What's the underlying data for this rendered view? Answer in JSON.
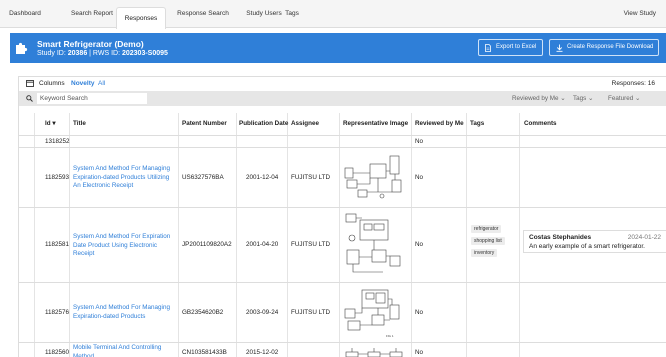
{
  "nav": {
    "tabs": [
      {
        "label": "Dashboard"
      },
      {
        "label": "Search Report"
      },
      {
        "label": "Responses"
      },
      {
        "label": "Response Search"
      },
      {
        "label": "Study Users"
      },
      {
        "label": "Tags"
      }
    ],
    "active_tab": "Responses",
    "view_study": "View Study"
  },
  "header": {
    "title": "Smart Refrigerator (Demo)",
    "study_id_label": "Study ID:",
    "study_id": "20386",
    "rws_label": "| RWS ID:",
    "rws_id": "202303-S0095",
    "export_label": "Export to Excel",
    "create_label": "Create Response File Download",
    "color": "#2f7fd8"
  },
  "toolbar": {
    "columns_label": "Columns",
    "novelty_label": "Novelty",
    "all_label": "All",
    "responses_label": "Responses: 16",
    "search_placeholder": "Keyword Search",
    "filters": {
      "reviewed": "Reviewed by Me",
      "tags": "Tags",
      "featured": "Featured"
    }
  },
  "table": {
    "headers": {
      "id": "Id",
      "title": "Title",
      "patent": "Patent Number",
      "pubdate": "Publication Date",
      "assignee": "Assignee",
      "image": "Representative Image",
      "reviewed": "Reviewed by Me",
      "tags": "Tags",
      "comments": "Comments"
    },
    "rows": [
      {
        "id": "1318252",
        "title": "",
        "patent": "",
        "pubdate": "",
        "assignee": "",
        "reviewed": "No"
      },
      {
        "id": "1182593",
        "title": "System And Method For Managing Expiration-dated Products Utilizing An Electronic Receipt",
        "patent": "US6327576BA",
        "pubdate": "2001-12-04",
        "assignee": "FUJITSU LTD",
        "reviewed": "No"
      },
      {
        "id": "1182581",
        "title": "System And Method For Expiration Date Product Using Electronic Receipt",
        "patent": "JP2001109820A2",
        "pubdate": "2001-04-20",
        "assignee": "FUJITSU LTD",
        "reviewed": "No",
        "tags": [
          "refrigerator",
          "shopping list",
          "inventory"
        ],
        "comment": {
          "user": "Costas Stephanides",
          "date": "2024-01-22",
          "text": "An early example of a smart refrigerator."
        }
      },
      {
        "id": "1182576",
        "title": "System And Method For Managing Expiration-dated Products",
        "patent": "GB2354620B2",
        "pubdate": "2003-09-24",
        "assignee": "FUJITSU LTD",
        "reviewed": "No"
      },
      {
        "id": "1182560",
        "title": "Mobile Terminal And Controlling Method",
        "patent": "CN103581433B",
        "pubdate": "2015-12-02",
        "assignee": "",
        "reviewed": "No"
      }
    ]
  }
}
